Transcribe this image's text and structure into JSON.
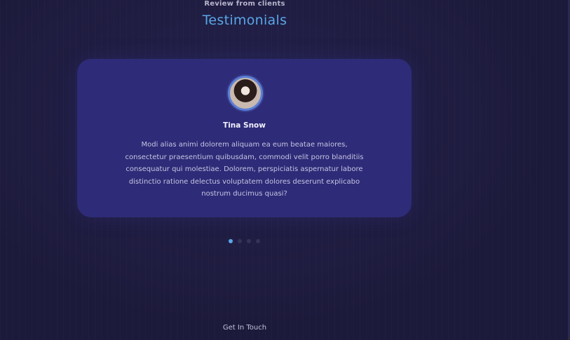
{
  "section": {
    "subtitle": "Review from clients",
    "title": "Testimonials"
  },
  "testimonial": {
    "avatar_icon": "avatar-photo",
    "name": "Tina Snow",
    "quote": "Modi alias animi dolorem aliquam ea eum beatae maiores, consectetur praesentium quibusdam, commodi velit porro blanditiis consequatur qui molestiae. Dolorem, perspiciatis aspernatur labore distinctio ratione delectus voluptatem dolores deserunt explicabo nostrum ducimus quasi?"
  },
  "carousel": {
    "slide_count": 4,
    "active_index": 0
  },
  "footer": {
    "contact_label": "Get In Touch"
  },
  "colors": {
    "background": "#1c1a3a",
    "card": "#2e2b78",
    "accent": "#5aa7e8"
  }
}
